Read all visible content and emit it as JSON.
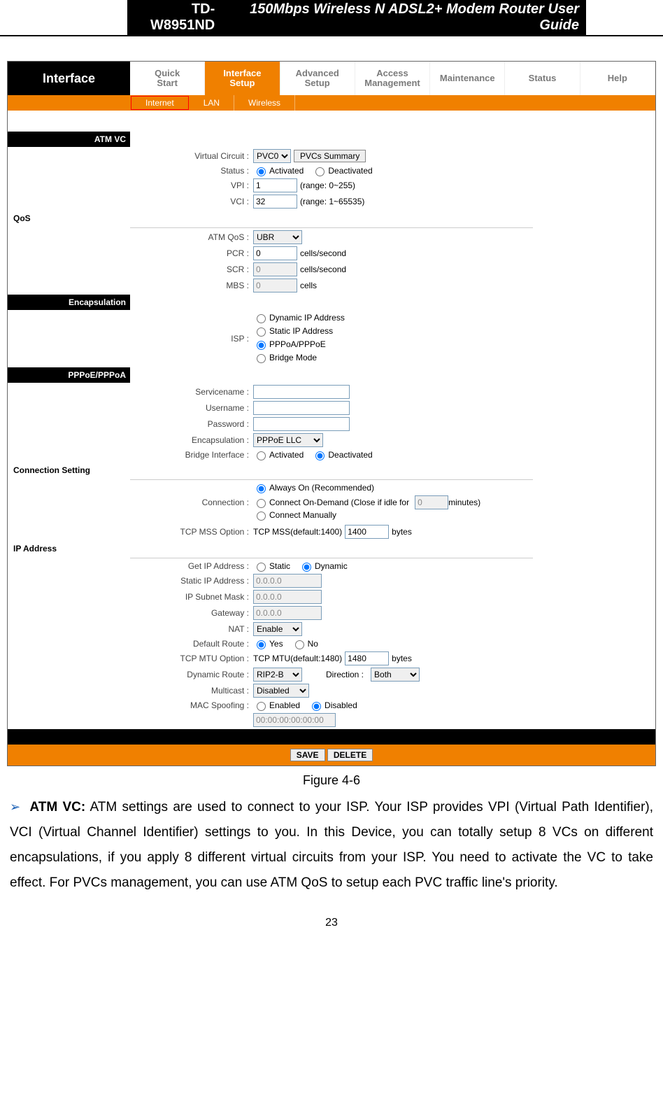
{
  "header": {
    "model": "TD-W8951ND",
    "title": "150Mbps Wireless N ADSL2+ Modem Router User Guide"
  },
  "nav": {
    "section": "Interface",
    "items": [
      "Quick\nStart",
      "Interface\nSetup",
      "Advanced\nSetup",
      "Access\nManagement",
      "Maintenance",
      "Status",
      "Help"
    ],
    "active": 1,
    "sub": [
      "Internet",
      "LAN",
      "Wireless"
    ],
    "sub_active": 0
  },
  "atm_vc": {
    "heading": "ATM VC",
    "virtual_circuit_label": "Virtual Circuit :",
    "virtual_circuit_value": "PVC0",
    "pvcs_summary_btn": "PVCs Summary",
    "status_label": "Status :",
    "status_options": [
      "Activated",
      "Deactivated"
    ],
    "status_selected": 0,
    "vpi_label": "VPI :",
    "vpi_value": "1",
    "vpi_hint": "(range: 0~255)",
    "vci_label": "VCI :",
    "vci_value": "32",
    "vci_hint": "(range: 1~65535)"
  },
  "qos": {
    "heading": "QoS",
    "atm_qos_label": "ATM QoS :",
    "atm_qos_value": "UBR",
    "pcr_label": "PCR :",
    "pcr_value": "0",
    "pcr_unit": "cells/second",
    "scr_label": "SCR :",
    "scr_value": "0",
    "scr_unit": "cells/second",
    "mbs_label": "MBS :",
    "mbs_value": "0",
    "mbs_unit": "cells"
  },
  "encap": {
    "heading": "Encapsulation",
    "isp_label": "ISP :",
    "isp_options": [
      "Dynamic IP Address",
      "Static IP Address",
      "PPPoA/PPPoE",
      "Bridge Mode"
    ],
    "isp_selected": 2
  },
  "pppoe": {
    "heading": "PPPoE/PPPoA",
    "servicename_label": "Servicename :",
    "servicename_value": "",
    "username_label": "Username :",
    "username_value": "",
    "password_label": "Password :",
    "password_value": "",
    "encap_label": "Encapsulation :",
    "encap_value": "PPPoE LLC",
    "bridge_iface_label": "Bridge Interface :",
    "bridge_options": [
      "Activated",
      "Deactivated"
    ],
    "bridge_selected": 1
  },
  "conn": {
    "heading": "Connection Setting",
    "connection_label": "Connection :",
    "conn_options": [
      "Always On (Recommended)",
      "Connect On-Demand (Close if idle for",
      "Connect Manually"
    ],
    "conn_selected": 0,
    "idle_value": "0",
    "idle_suffix": "minutes)",
    "tcp_mss_label": "TCP MSS Option :",
    "tcp_mss_prefix": "TCP MSS(default:1400)",
    "tcp_mss_value": "1400",
    "tcp_mss_unit": "bytes"
  },
  "ip": {
    "heading": "IP Address",
    "get_ip_label": "Get IP Address :",
    "get_ip_options": [
      "Static",
      "Dynamic"
    ],
    "get_ip_selected": 1,
    "static_ip_label": "Static IP Address :",
    "static_ip_value": "0.0.0.0",
    "subnet_label": "IP Subnet Mask :",
    "subnet_value": "0.0.0.0",
    "gateway_label": "Gateway :",
    "gateway_value": "0.0.0.0",
    "nat_label": "NAT :",
    "nat_value": "Enable",
    "default_route_label": "Default Route :",
    "default_route_options": [
      "Yes",
      "No"
    ],
    "default_route_selected": 0,
    "tcp_mtu_label": "TCP MTU Option :",
    "tcp_mtu_prefix": "TCP MTU(default:1480)",
    "tcp_mtu_value": "1480",
    "tcp_mtu_unit": "bytes",
    "dyn_route_label": "Dynamic Route :",
    "dyn_route_value": "RIP2-B",
    "direction_label": "Direction :",
    "direction_value": "Both",
    "multicast_label": "Multicast :",
    "multicast_value": "Disabled",
    "mac_spoof_label": "MAC Spoofing :",
    "mac_spoof_options": [
      "Enabled",
      "Disabled"
    ],
    "mac_spoof_selected": 1,
    "mac_value": "00:00:00:00:00:00"
  },
  "buttons": {
    "save": "SAVE",
    "delete": "DELETE"
  },
  "caption": "Figure 4-6",
  "description": {
    "bold": "ATM VC:",
    "text": " ATM settings are used to connect to your ISP. Your ISP provides VPI (Virtual Path Identifier), VCI (Virtual Channel Identifier) settings to you. In this Device, you can totally setup 8 VCs on different encapsulations, if you apply 8 different virtual circuits from your ISP. You need to activate the VC to take effect. For PVCs management, you can use ATM QoS to setup each PVC traffic line's priority."
  },
  "page_number": "23"
}
